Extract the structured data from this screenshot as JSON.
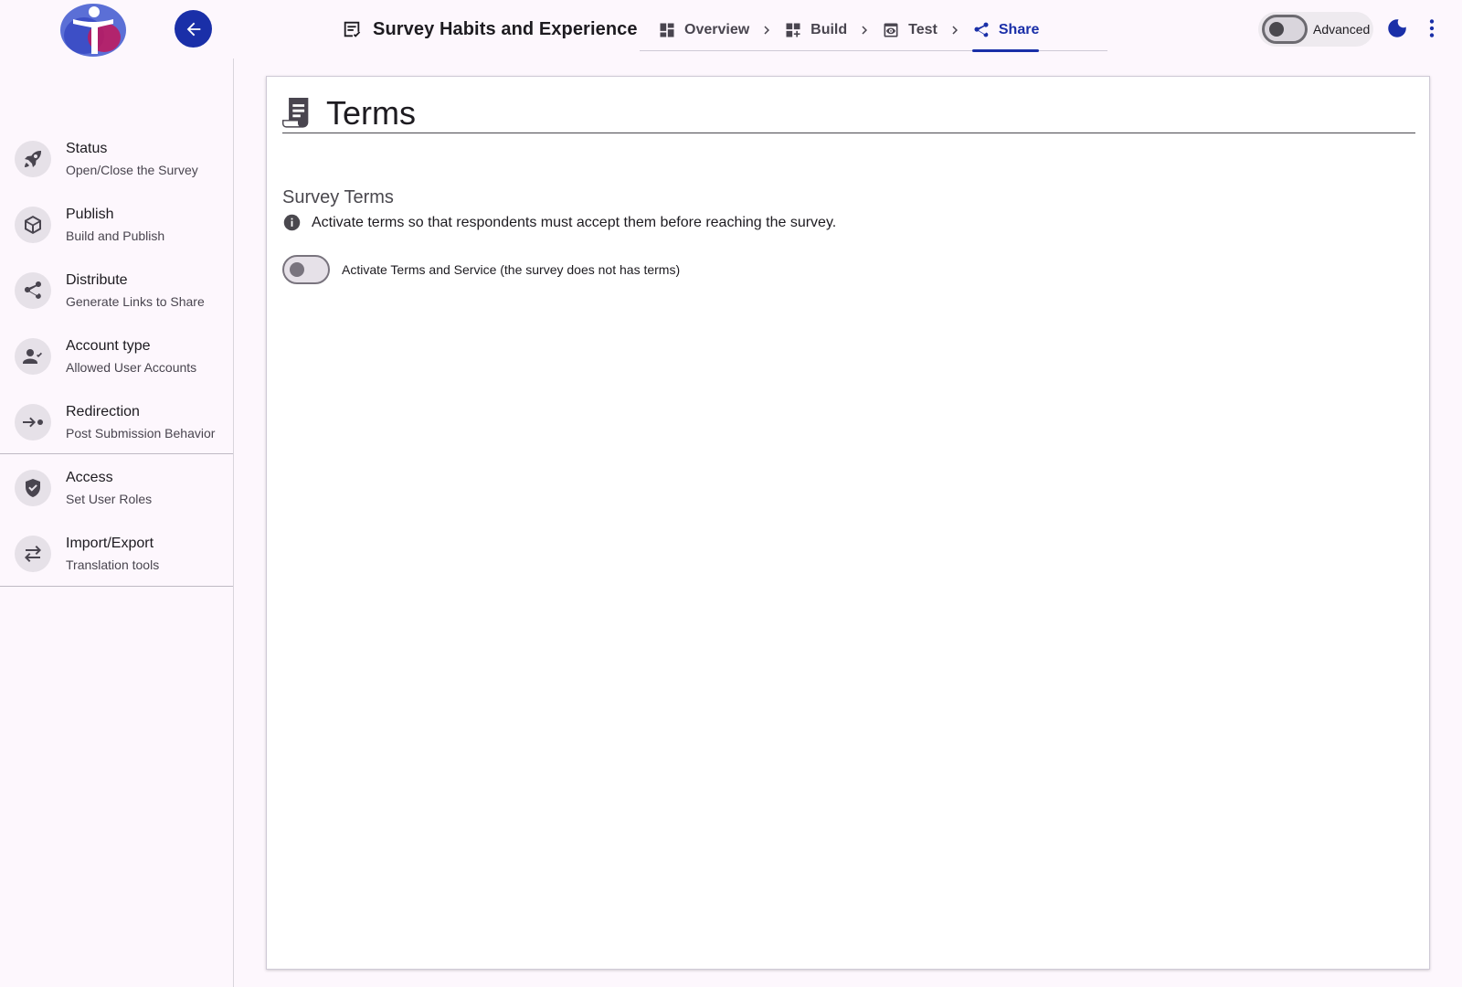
{
  "header": {
    "survey_title": "Survey Habits and Experience",
    "steps": [
      {
        "label": "Overview",
        "icon": "dashboard-icon",
        "active": false
      },
      {
        "label": "Build",
        "icon": "build-grid-icon",
        "active": false
      },
      {
        "label": "Test",
        "icon": "preview-icon",
        "active": false
      },
      {
        "label": "Share",
        "icon": "share-icon",
        "active": true
      }
    ],
    "advanced_label": "Advanced",
    "advanced_enabled": false
  },
  "sidebar": {
    "items": [
      {
        "title": "Status",
        "subtitle": "Open/Close the Survey",
        "icon": "rocket-icon"
      },
      {
        "title": "Publish",
        "subtitle": "Build and Publish",
        "icon": "package-icon"
      },
      {
        "title": "Distribute",
        "subtitle": "Generate Links to Share",
        "icon": "share-icon"
      },
      {
        "title": "Account type",
        "subtitle": "Allowed User Accounts",
        "icon": "person-check-icon"
      },
      {
        "title": "Redirection",
        "subtitle": "Post Submission Behavior",
        "icon": "redirect-icon"
      },
      {
        "title": "Access",
        "subtitle": "Set User Roles",
        "icon": "shield-check-icon"
      },
      {
        "title": "Import/Export",
        "subtitle": "Translation tools",
        "icon": "swap-arrows-icon"
      }
    ]
  },
  "main": {
    "title": "Terms",
    "section_title": "Survey Terms",
    "info_text": "Activate terms so that respondents must accept them before reaching the survey.",
    "toggle_label": "Activate Terms and Service (the survey does not has terms)",
    "toggle_enabled": false
  },
  "colors": {
    "accent": "#1a2fa8",
    "background": "#fdf7fd"
  }
}
